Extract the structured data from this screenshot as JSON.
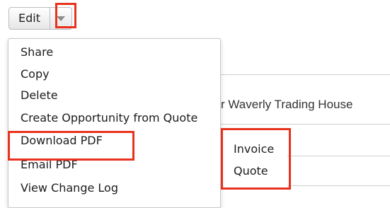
{
  "toolbar": {
    "edit_label": "Edit",
    "caret_icon": "chevron-down-icon"
  },
  "background": {
    "record_name_fragment": "r Waverly Trading House"
  },
  "actions_menu": {
    "items": [
      {
        "label": "Share"
      },
      {
        "label": "Copy"
      },
      {
        "label": "Delete"
      },
      {
        "label": "Create Opportunity from Quote"
      },
      {
        "label": "Download PDF"
      },
      {
        "label": "Email PDF"
      },
      {
        "label": "View Change Log"
      }
    ]
  },
  "download_submenu": {
    "items": [
      {
        "label": "Invoice"
      },
      {
        "label": "Quote"
      }
    ]
  },
  "colors": {
    "highlight": "#e8321e",
    "button_border": "#bdbdbd",
    "menu_border": "#c8c8c8"
  }
}
